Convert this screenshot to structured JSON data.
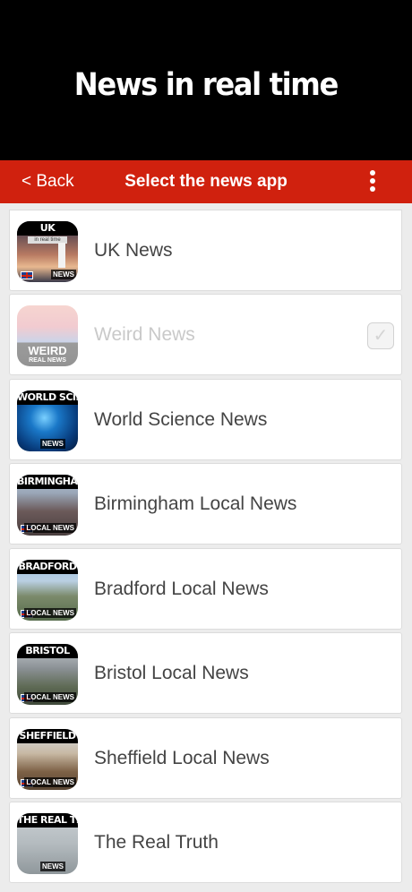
{
  "banner": {
    "title": "News in real time"
  },
  "navbar": {
    "back_label": "< Back",
    "title": "Select the news app"
  },
  "apps": [
    {
      "label": "UK News",
      "icon_top": "UK",
      "icon_sub": "in real time",
      "icon_bottom": "NEWS",
      "enabled": true
    },
    {
      "label": "Weird News",
      "icon_main": "WEIRD",
      "icon_sub": "REAL NEWS",
      "enabled": false,
      "checked": true
    },
    {
      "label": "World Science News",
      "icon_top": "WORLD SCIENCE",
      "icon_bottom": "NEWS",
      "enabled": true
    },
    {
      "label": "Birmingham Local News",
      "icon_top": "BIRMINGHAM A",
      "icon_bottom": "LOCAL NEWS",
      "enabled": true
    },
    {
      "label": "Bradford Local News",
      "icon_top": "BRADFORD",
      "icon_bottom": "LOCAL NEWS",
      "enabled": true
    },
    {
      "label": "Bristol Local News",
      "icon_top": "BRISTOL",
      "icon_bottom": "LOCAL NEWS",
      "enabled": true
    },
    {
      "label": "Sheffield Local News",
      "icon_top": "SHEFFIELD",
      "icon_bottom": "LOCAL NEWS",
      "enabled": true
    },
    {
      "label": "The Real Truth",
      "icon_top": "THE REAL TRUTH",
      "icon_bottom": "NEWS",
      "enabled": true
    }
  ],
  "colors": {
    "banner": "#000000",
    "navbar": "#d0210e",
    "background": "#ececec"
  }
}
